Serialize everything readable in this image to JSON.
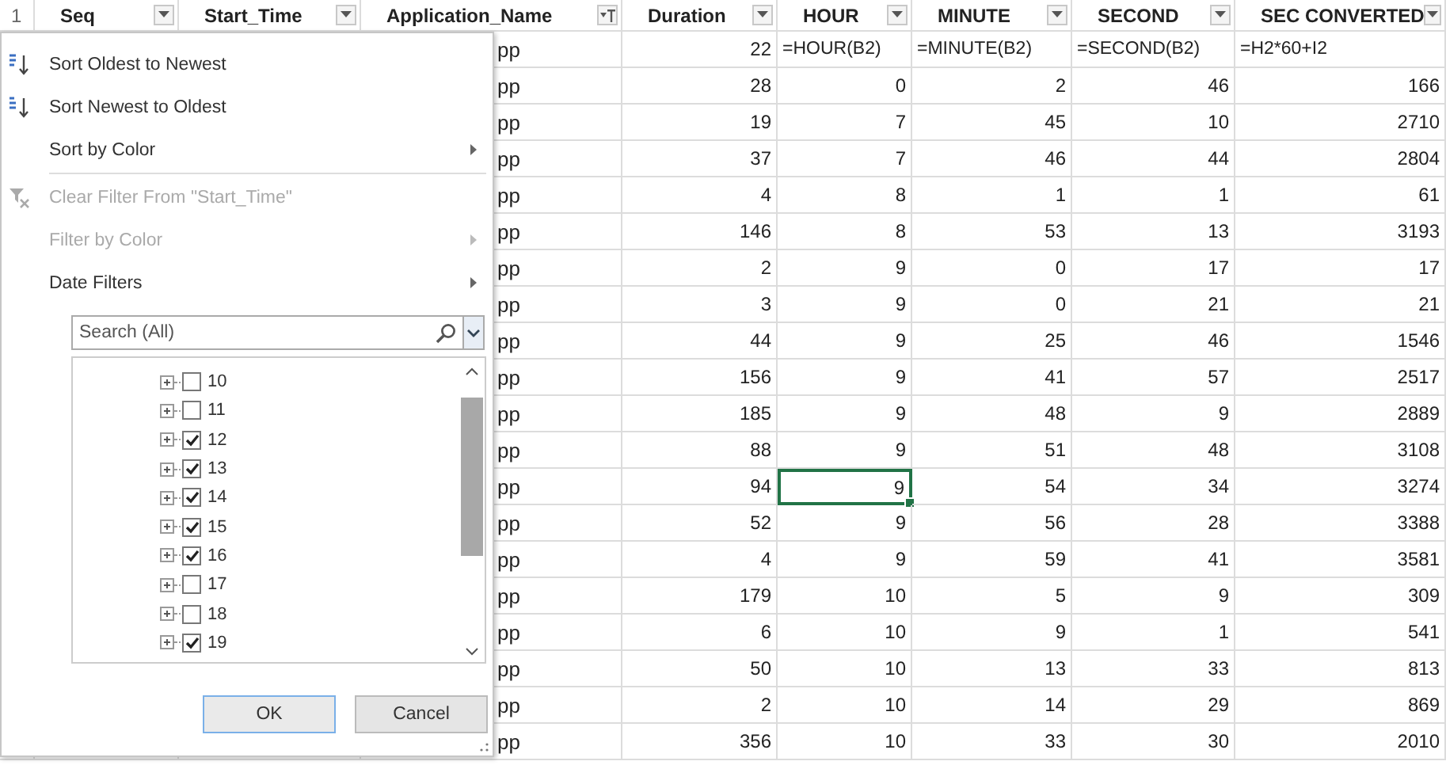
{
  "sheet": {
    "row_number": "1",
    "columns": [
      {
        "label": "Seq",
        "filtered": false
      },
      {
        "label": "Start_Time",
        "filtered": false
      },
      {
        "label": "Application_Name",
        "filtered": true
      },
      {
        "label": "Duration",
        "filtered": false
      },
      {
        "label": "HOUR",
        "filtered": false
      },
      {
        "label": "MINUTE",
        "filtered": false
      },
      {
        "label": "SECOND",
        "filtered": false
      },
      {
        "label": "SEC CONVERTED",
        "filtered": false
      }
    ],
    "rows": [
      {
        "kind": "formula",
        "app_name": "pp",
        "duration": "22",
        "hour": "=HOUR(B2)",
        "minute": "=MINUTE(B2)",
        "second": "=SECOND(B2)",
        "sec_converted": "=H2*60+I2",
        "hour_selected": false
      },
      {
        "kind": "value",
        "app_name": "pp",
        "duration": "28",
        "hour": "0",
        "minute": "2",
        "second": "46",
        "sec_converted": "166",
        "hour_selected": false
      },
      {
        "kind": "value",
        "app_name": "pp",
        "duration": "19",
        "hour": "7",
        "minute": "45",
        "second": "10",
        "sec_converted": "2710",
        "hour_selected": false
      },
      {
        "kind": "value",
        "app_name": "pp",
        "duration": "37",
        "hour": "7",
        "minute": "46",
        "second": "44",
        "sec_converted": "2804",
        "hour_selected": false
      },
      {
        "kind": "value",
        "app_name": "pp",
        "duration": "4",
        "hour": "8",
        "minute": "1",
        "second": "1",
        "sec_converted": "61",
        "hour_selected": false
      },
      {
        "kind": "value",
        "app_name": "pp",
        "duration": "146",
        "hour": "8",
        "minute": "53",
        "second": "13",
        "sec_converted": "3193",
        "hour_selected": false
      },
      {
        "kind": "value",
        "app_name": "pp",
        "duration": "2",
        "hour": "9",
        "minute": "0",
        "second": "17",
        "sec_converted": "17",
        "hour_selected": false
      },
      {
        "kind": "value",
        "app_name": "pp",
        "duration": "3",
        "hour": "9",
        "minute": "0",
        "second": "21",
        "sec_converted": "21",
        "hour_selected": false
      },
      {
        "kind": "value",
        "app_name": "pp",
        "duration": "44",
        "hour": "9",
        "minute": "25",
        "second": "46",
        "sec_converted": "1546",
        "hour_selected": false
      },
      {
        "kind": "value",
        "app_name": "pp",
        "duration": "156",
        "hour": "9",
        "minute": "41",
        "second": "57",
        "sec_converted": "2517",
        "hour_selected": false
      },
      {
        "kind": "value",
        "app_name": "pp",
        "duration": "185",
        "hour": "9",
        "minute": "48",
        "second": "9",
        "sec_converted": "2889",
        "hour_selected": false
      },
      {
        "kind": "value",
        "app_name": "pp",
        "duration": "88",
        "hour": "9",
        "minute": "51",
        "second": "48",
        "sec_converted": "3108",
        "hour_selected": false
      },
      {
        "kind": "value",
        "app_name": "pp",
        "duration": "94",
        "hour": "9",
        "minute": "54",
        "second": "34",
        "sec_converted": "3274",
        "hour_selected": true
      },
      {
        "kind": "value",
        "app_name": "pp",
        "duration": "52",
        "hour": "9",
        "minute": "56",
        "second": "28",
        "sec_converted": "3388",
        "hour_selected": false
      },
      {
        "kind": "value",
        "app_name": "pp",
        "duration": "4",
        "hour": "9",
        "minute": "59",
        "second": "41",
        "sec_converted": "3581",
        "hour_selected": false
      },
      {
        "kind": "value",
        "app_name": "pp",
        "duration": "179",
        "hour": "10",
        "minute": "5",
        "second": "9",
        "sec_converted": "309",
        "hour_selected": false
      },
      {
        "kind": "value",
        "app_name": "pp",
        "duration": "6",
        "hour": "10",
        "minute": "9",
        "second": "1",
        "sec_converted": "541",
        "hour_selected": false
      },
      {
        "kind": "value",
        "app_name": "pp",
        "duration": "50",
        "hour": "10",
        "minute": "13",
        "second": "33",
        "sec_converted": "813",
        "hour_selected": false
      },
      {
        "kind": "value",
        "app_name": "pp",
        "duration": "2",
        "hour": "10",
        "minute": "14",
        "second": "29",
        "sec_converted": "869",
        "hour_selected": false
      },
      {
        "kind": "value",
        "app_name": "pp",
        "duration": "356",
        "hour": "10",
        "minute": "33",
        "second": "30",
        "sec_converted": "2010",
        "hour_selected": false
      }
    ]
  },
  "filter_menu": {
    "groups": [
      [
        {
          "kind": "sort_asc",
          "label": "Sort Oldest to Newest",
          "disabled": false,
          "submenu": false
        },
        {
          "kind": "sort_desc",
          "label": "Sort Newest to Oldest",
          "disabled": false,
          "submenu": false
        },
        {
          "kind": "plain",
          "label": "Sort by Color",
          "disabled": false,
          "submenu": true
        }
      ],
      [
        {
          "kind": "clear_filter",
          "label": "Clear Filter From \"Start_Time\"",
          "disabled": true,
          "submenu": false
        },
        {
          "kind": "plain",
          "label": "Filter by Color",
          "disabled": true,
          "submenu": true
        },
        {
          "kind": "plain",
          "label": "Date Filters",
          "disabled": false,
          "submenu": true
        }
      ]
    ],
    "search": {
      "placeholder": "Search (All)"
    },
    "values": [
      {
        "label": "10",
        "checked": false
      },
      {
        "label": "11",
        "checked": false
      },
      {
        "label": "12",
        "checked": true
      },
      {
        "label": "13",
        "checked": true
      },
      {
        "label": "14",
        "checked": true
      },
      {
        "label": "15",
        "checked": true
      },
      {
        "label": "16",
        "checked": true
      },
      {
        "label": "17",
        "checked": false
      },
      {
        "label": "18",
        "checked": false
      },
      {
        "label": "19",
        "checked": true
      }
    ],
    "buttons": [
      {
        "label": "OK",
        "default": true
      },
      {
        "label": "Cancel",
        "default": false
      }
    ]
  }
}
